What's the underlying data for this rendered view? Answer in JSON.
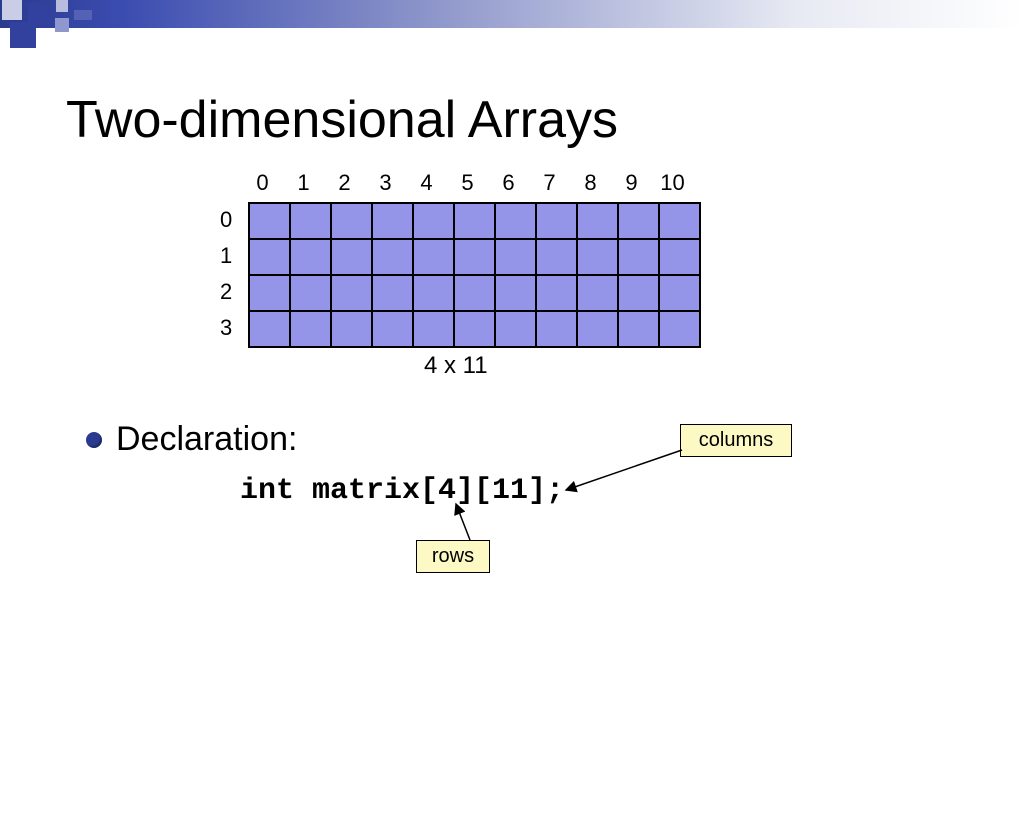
{
  "title": "Two-dimensional Arrays",
  "grid": {
    "col_labels": [
      "0",
      "1",
      "2",
      "3",
      "4",
      "5",
      "6",
      "7",
      "8",
      "9",
      "10"
    ],
    "row_labels": [
      "0",
      "1",
      "2",
      "3"
    ],
    "dimension_label": "4 x 11",
    "rows": 4,
    "cols": 11
  },
  "bullet": {
    "label": "Declaration:"
  },
  "code": "int matrix[4][11];",
  "callouts": {
    "columns": "columns",
    "rows": "rows"
  },
  "chart_data": {
    "type": "table",
    "title": "Two-dimensional Arrays",
    "rows": 4,
    "cols": 11,
    "row_indices": [
      0,
      1,
      2,
      3
    ],
    "col_indices": [
      0,
      1,
      2,
      3,
      4,
      5,
      6,
      7,
      8,
      9,
      10
    ],
    "declaration": "int matrix[4][11];",
    "annotations": {
      "first_bracket": "rows",
      "second_bracket": "columns"
    }
  }
}
